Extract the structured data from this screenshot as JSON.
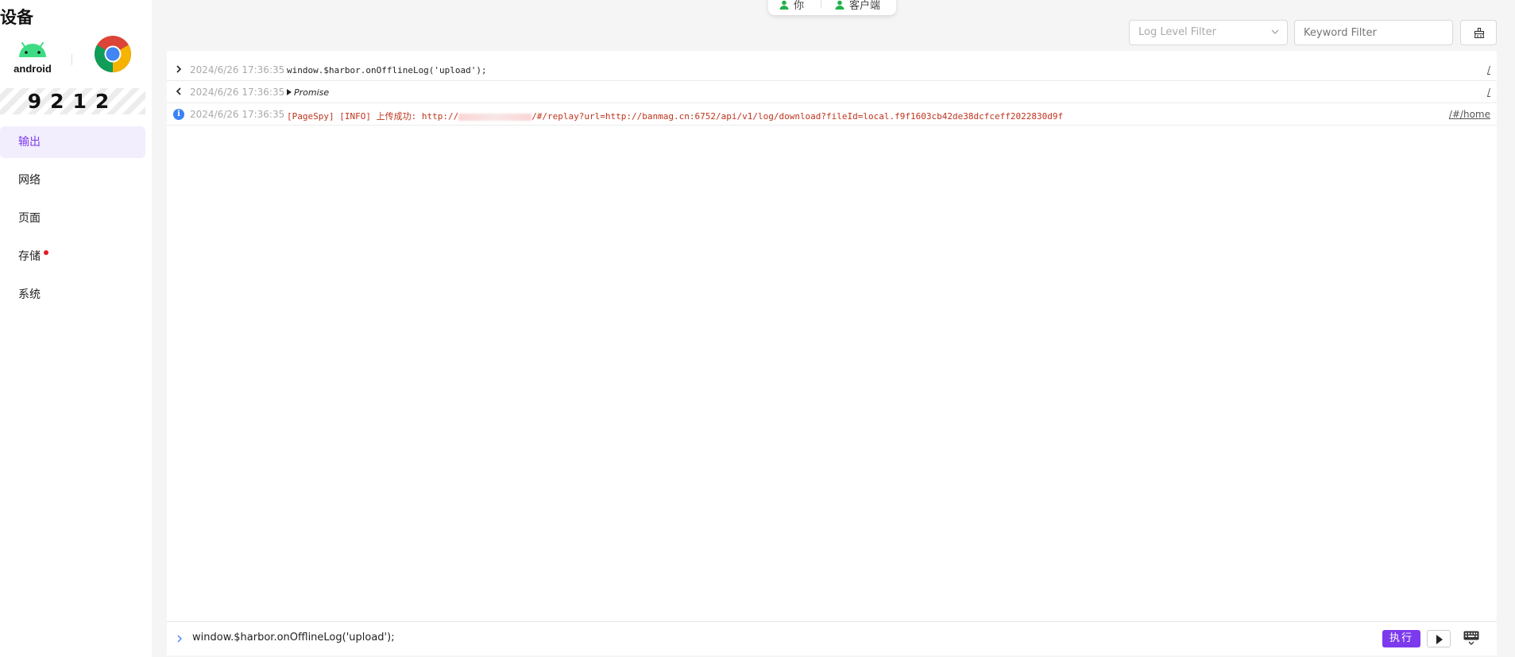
{
  "sidebar": {
    "title": "设备",
    "android_label": "android",
    "device_code": "9212",
    "items": [
      {
        "label": "输出",
        "active": true
      },
      {
        "label": "网络"
      },
      {
        "label": "页面"
      },
      {
        "label": "存储",
        "dot": true
      },
      {
        "label": "系统"
      }
    ]
  },
  "top_pill": {
    "you_label": "你",
    "client_label": "客户端"
  },
  "filters": {
    "level_placeholder": "Log Level Filter",
    "keyword_placeholder": "Keyword Filter"
  },
  "console": {
    "rows": [
      {
        "type": "input",
        "time": "2024/6/26 17:36:35",
        "message": "window.$harbor.onOfflineLog('upload');",
        "source": "/"
      },
      {
        "type": "output",
        "time": "2024/6/26 17:36:35",
        "message": "Promise",
        "source": "/"
      },
      {
        "type": "info",
        "time": "2024/6/26 17:36:35",
        "message_prefix": "[PageSpy] [INFO]  上传成功: http://",
        "message_suffix": "/#/replay?url=http://banmag.cn:6752/api/v1/log/download?fileId=local.f9f1603cb42de38dcfceff2022830d9f",
        "source": "/#/home"
      }
    ]
  },
  "input_bar": {
    "code": "window.$harbor.onOfflineLog('upload');",
    "exec_label": "执行"
  },
  "colors": {
    "accent": "#7c3aed",
    "info": "#3b82f6",
    "error_text": "#c0341d"
  }
}
